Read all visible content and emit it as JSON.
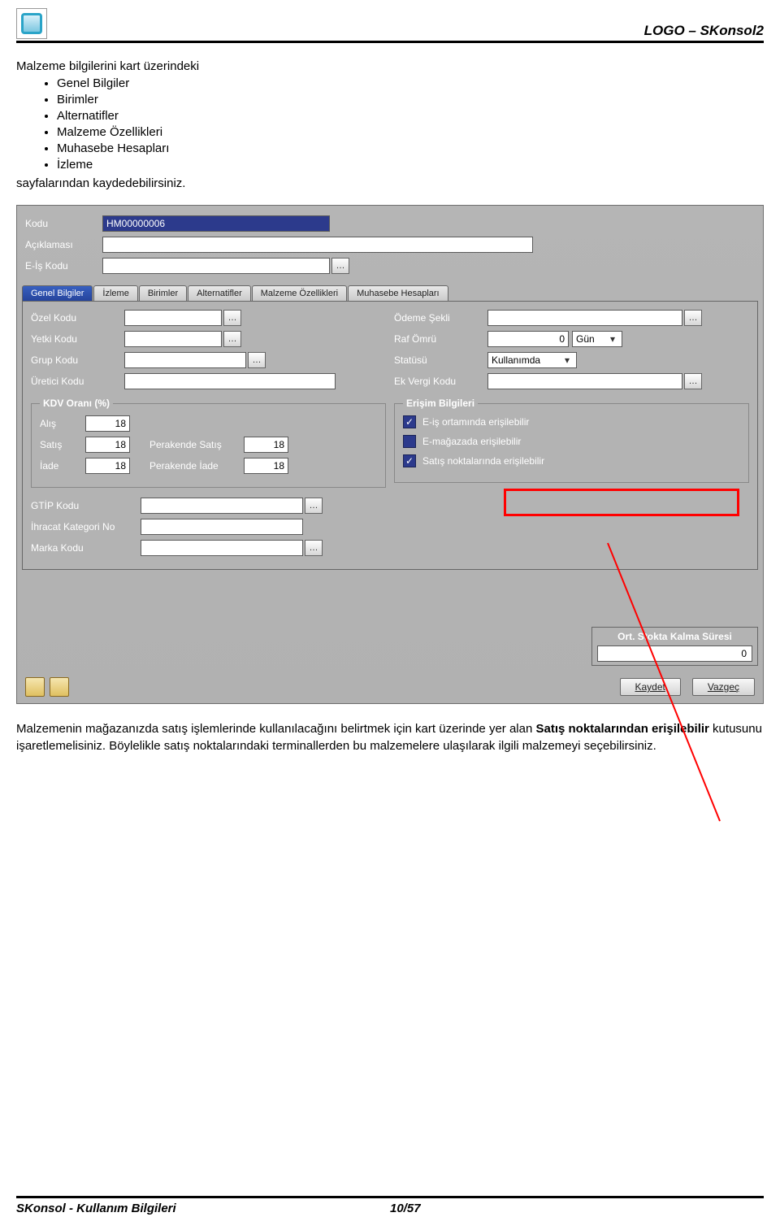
{
  "header": {
    "title": "LOGO – SKonsol2"
  },
  "intro": {
    "lead": "Malzeme bilgilerini kart üzerindeki",
    "bullets": [
      "Genel Bilgiler",
      "Birimler",
      "Alternatifler",
      "Malzeme Özellikleri",
      "Muhasebe Hesapları",
      "İzleme"
    ],
    "tail": "sayfalarından kaydedebilirsiniz."
  },
  "form": {
    "labels": {
      "kodu": "Kodu",
      "aciklamasi": "Açıklaması",
      "eis": "E-İş Kodu"
    },
    "values": {
      "kodu": "HM00000006",
      "aciklamasi": "",
      "eis": ""
    }
  },
  "tabs": [
    "Genel Bilgiler",
    "İzleme",
    "Birimler",
    "Alternatifler",
    "Malzeme Özellikleri",
    "Muhasebe Hesapları"
  ],
  "leftFields": {
    "ozel": "Özel Kodu",
    "yetki": "Yetki Kodu",
    "grup": "Grup Kodu",
    "uretici": "Üretici Kodu"
  },
  "rightFields": {
    "odeme": "Ödeme Şekli",
    "raf": "Raf Ömrü",
    "rafVal": "0",
    "rafUnit": "Gün",
    "status": "Statüsü",
    "statusVal": "Kullanımda",
    "ekvergi": "Ek Vergi Kodu"
  },
  "kdv": {
    "legend": "KDV Oranı (%)",
    "rows": {
      "alis": "Alış",
      "alisVal": "18",
      "satis": "Satış",
      "satisVal": "18",
      "perSatis": "Perakende Satış",
      "perSatisVal": "18",
      "iade": "İade",
      "iadeVal": "18",
      "perIade": "Perakende İade",
      "perIadeVal": "18"
    }
  },
  "erisim": {
    "legend": "Erişim Bilgileri",
    "items": [
      "E-iş ortamında erişilebilir",
      "E-mağazada erişilebilir",
      "Satış noktalarında erişilebilir"
    ],
    "checks": [
      true,
      false,
      true
    ]
  },
  "extra": {
    "gtip": "GTİP Kodu",
    "ihracat": "İhracat Kategori No",
    "marka": "Marka Kodu"
  },
  "ort": {
    "title": "Ort. Stokta Kalma Süresi",
    "val": "0"
  },
  "buttons": {
    "kaydet": "Kaydet",
    "vazgec": "Vazgeç"
  },
  "paragraph": {
    "p1a": "Malzemenin mağazanızda satış işlemlerinde kullanılacağını belirtmek için kart üzerinde yer alan ",
    "p1b": "Satış noktalarından erişilebilir",
    "p1c": " kutusunu işaretlemelisiniz.  Böylelikle satış noktalarındaki terminallerden  bu malzemelere ulaşılarak ilgili malzemeyi seçebilirsiniz."
  },
  "footer": {
    "left": "SKonsol - Kullanım Bilgileri",
    "center": "10/57"
  }
}
